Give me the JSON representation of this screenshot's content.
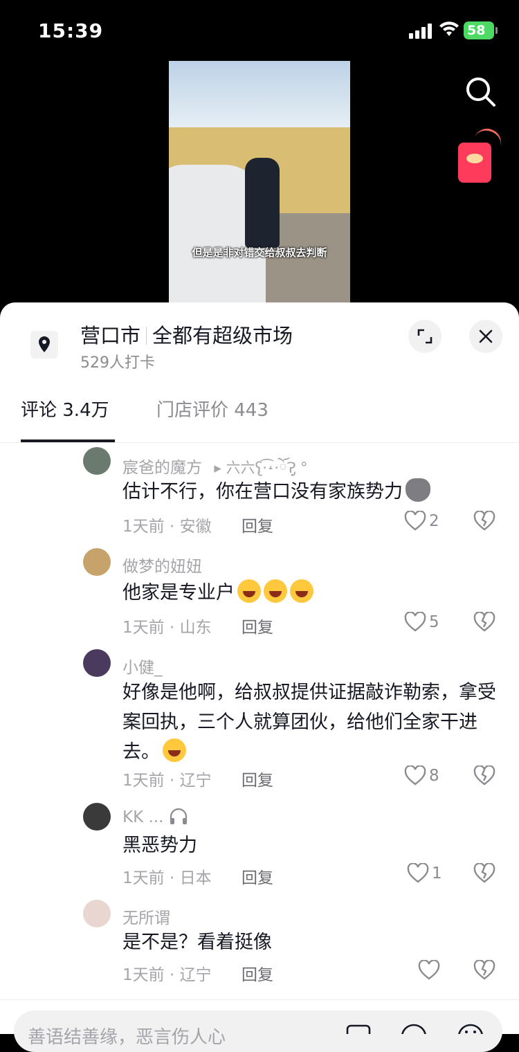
{
  "status_bar": {
    "time": "15:39",
    "battery": "58"
  },
  "video": {
    "subtitle": "但是是非对错交给叔叔去判断"
  },
  "sheet": {
    "location": "营口市",
    "store_name": "全都有超级市场",
    "checkins": "529人打卡",
    "tabs": [
      {
        "label": "评论 3.4万",
        "active": true
      },
      {
        "label": "门店评价 443",
        "active": false
      }
    ]
  },
  "comments": [
    {
      "username": "宸爸的魔方",
      "reply_to": "▸ 六六ʕ̢·͡˔·ོɁ̡̣ °",
      "text": "估计不行，你在营口没有家族势力",
      "emoji": "dog-emoji",
      "meta": "1天前 · 安徽",
      "reply": "回复",
      "likes": "2",
      "avatar_color": "#6a7a6e"
    },
    {
      "username": "做梦的妞妞",
      "text": "他家是专业户",
      "emoji": "laugh-cry-emoji x3",
      "meta": "1天前 · 山东",
      "reply": "回复",
      "likes": "5",
      "avatar_color": "#c6a36b"
    },
    {
      "username": "小健_",
      "text": "好像是他啊，给叔叔提供证据敲诈勒索，拿受案回执，三个人就算团伙，给他们全家干进去。",
      "emoji": "thinking-emoji",
      "meta": "1天前 · 辽宁",
      "reply": "回复",
      "likes": "8",
      "avatar_color": "#4a3b5e"
    },
    {
      "username": "KK ...",
      "text": "黑恶势力",
      "emoji": "headphones-icon",
      "meta": "1天前 · 日本",
      "reply": "回复",
      "likes": "1",
      "avatar_color": "#3a3a3a"
    },
    {
      "username": "无所谓",
      "text": "是不是？看着挺像",
      "meta": "1天前 · 辽宁",
      "reply": "回复",
      "likes": "",
      "avatar_color": "#e9d6d0"
    }
  ],
  "input": {
    "placeholder": "善语结善缘，恶言伤人心"
  }
}
